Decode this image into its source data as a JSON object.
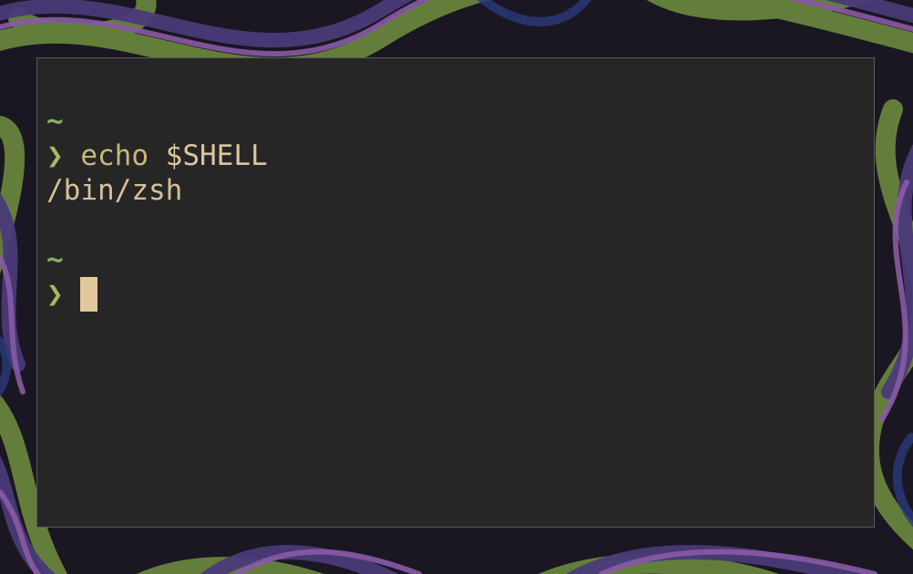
{
  "colors": {
    "terminal_bg": "#262626",
    "prompt_green": "#a9b665",
    "tilde_green": "#8dab6a",
    "text_tan": "#d4b98c",
    "cursor": "#e0c79c",
    "wallpaper_colors": [
      "#6b8a3d",
      "#4a3a78",
      "#8a5aa6",
      "#1a1622",
      "#2a3a7a"
    ]
  },
  "terminal": {
    "blocks": [
      {
        "cwd": "~",
        "prompt_symbol": "❯",
        "command": "echo",
        "argument": "$SHELL",
        "output": "/bin/zsh"
      },
      {
        "cwd": "~",
        "prompt_symbol": "❯",
        "command": "",
        "argument": "",
        "output": ""
      }
    ]
  }
}
